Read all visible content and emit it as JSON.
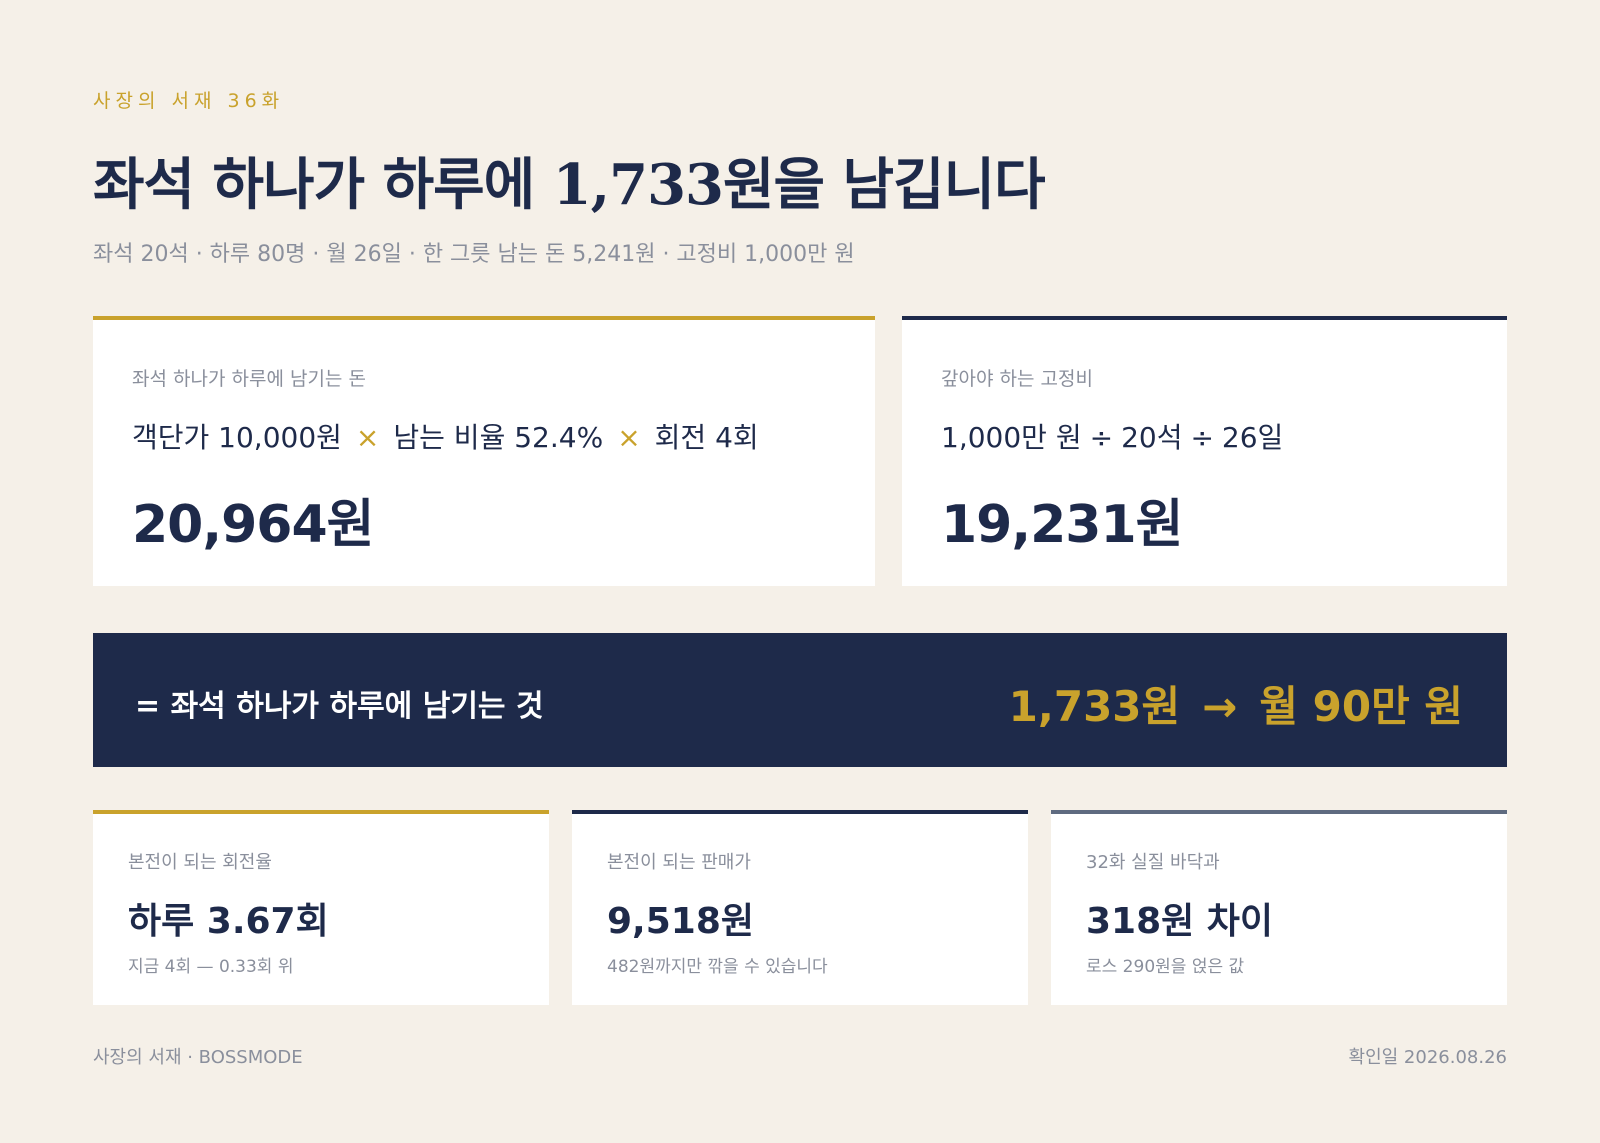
{
  "header": {
    "eyebrow": "사장의 서재 36화",
    "title": "좌석 하나가 하루에 1,733원을 남깁니다",
    "subtitle": "좌석 20석 · 하루 80명 · 월 26일 · 한 그릇 남는 돈 5,241원 · 고정비 1,000만 원"
  },
  "card_revenue": {
    "label": "좌석 하나가 하루에 남기는 돈",
    "term1": "객단가 10,000원",
    "op1": "×",
    "term2": "남는 비율 52.4%",
    "op2": "×",
    "term3": "회전 4회",
    "value": "20,964원"
  },
  "card_fixed": {
    "label": "갚아야 하는 고정비",
    "term1": "1,000만 원",
    "op1": "÷",
    "term2": "20석",
    "op2": "÷",
    "term3": "26일",
    "value": "19,231원"
  },
  "band": {
    "label": "= 좌석 하나가 하루에 남기는 것",
    "value_daily": "1,733원",
    "arrow": "→",
    "value_monthly": "월 90만 원"
  },
  "stats": [
    {
      "label": "본전이 되는 회전율",
      "value": "하루 3.67회",
      "note": "지금 4회 — 0.33회 위"
    },
    {
      "label": "본전이 되는 판매가",
      "value": "9,518원",
      "note": "482원까지만 깎을 수 있습니다"
    },
    {
      "label": "32화 실질 바닥과",
      "value": "318원 차이",
      "note": "로스 290원을 얹은 값"
    }
  ],
  "footer": {
    "left": "사장의 서재 · BOSSMODE",
    "right": "확인일 2026.08.26"
  },
  "colors": {
    "background": "#f5f0e8",
    "navy": "#1e2a4a",
    "gold": "#c9a22c",
    "slate": "#5f6b80",
    "muted": "#8a8f9c"
  }
}
